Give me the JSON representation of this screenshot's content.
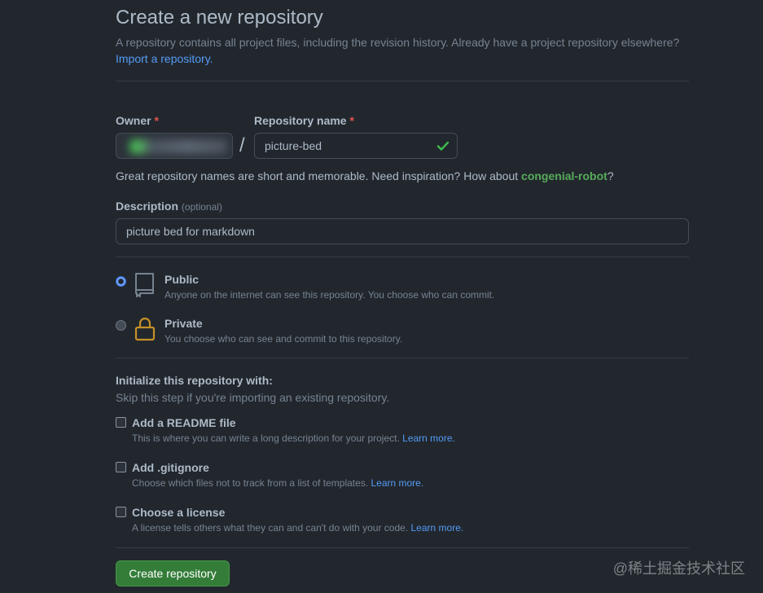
{
  "header": {
    "title": "Create a new repository",
    "subtitle": "A repository contains all project files, including the revision history. Already have a project repository elsewhere?",
    "import_link": "Import a repository."
  },
  "owner": {
    "label": "Owner",
    "required_mark": "*"
  },
  "repo_name": {
    "label": "Repository name",
    "required_mark": "*",
    "value": "picture-bed",
    "slash": "/"
  },
  "name_hint": {
    "text": "Great repository names are short and memorable. Need inspiration? How about ",
    "suggestion": "congenial-robot",
    "end": "?"
  },
  "description": {
    "label": "Description",
    "optional": "(optional)",
    "value": "picture bed for markdown"
  },
  "visibility": {
    "selected": "Public",
    "options": [
      {
        "title": "Public",
        "desc": "Anyone on the internet can see this repository. You choose who can commit.",
        "icon": "repo-icon"
      },
      {
        "title": "Private",
        "desc": "You choose who can see and commit to this repository.",
        "icon": "lock-icon"
      }
    ]
  },
  "init": {
    "title": "Initialize this repository with:",
    "subtitle": "Skip this step if you're importing an existing repository.",
    "options": [
      {
        "title": "Add a README file",
        "desc": "This is where you can write a long description for your project. ",
        "link": "Learn more."
      },
      {
        "title": "Add .gitignore",
        "desc": "Choose which files not to track from a list of templates. ",
        "link": "Learn more."
      },
      {
        "title": "Choose a license",
        "desc": "A license tells others what they can and can't do with your code. ",
        "link": "Learn more."
      }
    ]
  },
  "submit": {
    "label": "Create repository"
  },
  "watermark": "@稀土掘金技术社区",
  "colors": {
    "background": "#22272e",
    "accent_green": "#347d39",
    "link_blue": "#539bf5",
    "check_green": "#3fb950",
    "lock_gold": "#c69026"
  }
}
